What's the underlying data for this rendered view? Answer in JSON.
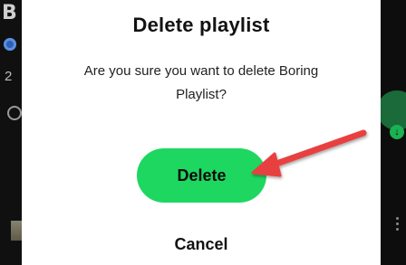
{
  "background": {
    "left_glyph": "B",
    "left_count": "2"
  },
  "dialog": {
    "title": "Delete playlist",
    "message": "Are you sure you want to delete Boring Playlist?",
    "confirm_label": "Delete",
    "cancel_label": "Cancel"
  },
  "annotation": {
    "arrow_color": "#e8413f",
    "target": "delete-button"
  },
  "colors": {
    "accent_green": "#1ed760",
    "dialog_bg": "#ffffff",
    "backdrop": "#121212"
  },
  "icons": {
    "background_icons": [
      "avatar-icon",
      "ring-icon",
      "download-icon",
      "more-vertical-icon"
    ]
  }
}
